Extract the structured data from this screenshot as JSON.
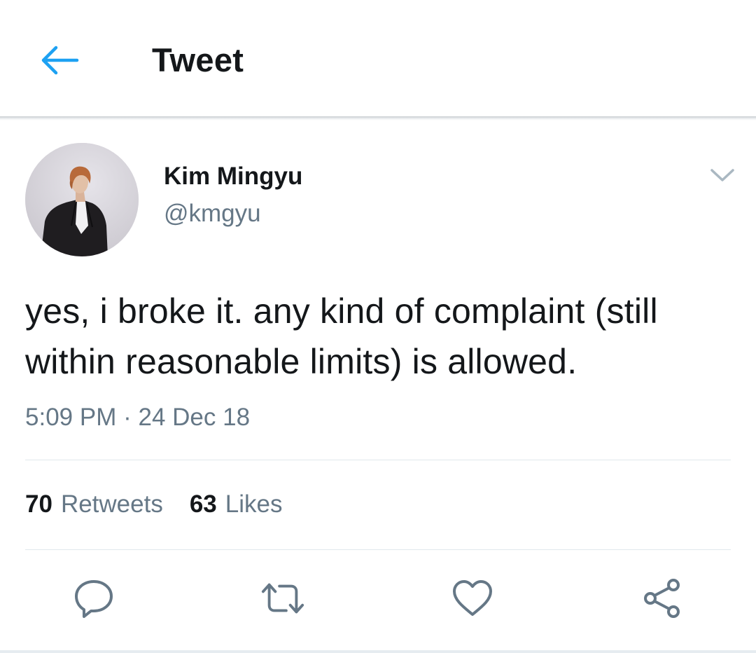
{
  "appbar": {
    "title": "Tweet",
    "back_icon": "arrow-left-icon",
    "accent_color": "#1da1f2"
  },
  "author": {
    "name": "Kim Mingyu",
    "handle": "@kmgyu",
    "menu_icon": "chevron-down-icon"
  },
  "tweet": {
    "text": "yes, i broke it. any kind of complaint (still within reasonable limits) is allowed.",
    "time": "5:09 PM",
    "separator": "·",
    "date": "24 Dec 18"
  },
  "stats": {
    "retweets_count": "70",
    "retweets_label": "Retweets",
    "likes_count": "63",
    "likes_label": "Likes"
  },
  "actions": {
    "reply_icon": "reply-icon",
    "retweet_icon": "retweet-icon",
    "like_icon": "heart-icon",
    "share_icon": "share-icon",
    "icon_color": "#657786"
  },
  "colors": {
    "primary_text": "#14171a",
    "secondary_text": "#657786",
    "divider": "#e1e8ed"
  }
}
